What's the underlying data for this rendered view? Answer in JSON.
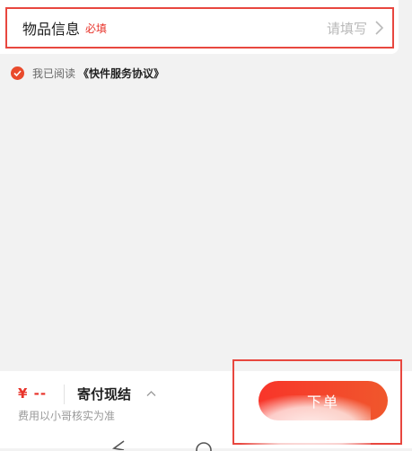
{
  "item_info": {
    "label": "物品信息",
    "required_tag": "必填",
    "placeholder": "请填写"
  },
  "agreement": {
    "checked": true,
    "prefix": "我已阅读",
    "link_text": "《快件服务协议》"
  },
  "bottom_bar": {
    "price": "¥ --",
    "payment_method": "寄付现结",
    "fee_note": "费用以小哥核实为准",
    "submit_label": "下单"
  },
  "colors": {
    "accent": "#e8332a",
    "button_start": "#f8352a",
    "button_end": "#f0572c",
    "highlight_box": "#e8473f"
  },
  "icons": {
    "chevron_right": "chevron-right-icon",
    "checkbox": "check-icon",
    "payment_toggle": "chevron-up-icon",
    "nav_back": "back-triangle-icon",
    "nav_home": "home-circle-icon"
  }
}
